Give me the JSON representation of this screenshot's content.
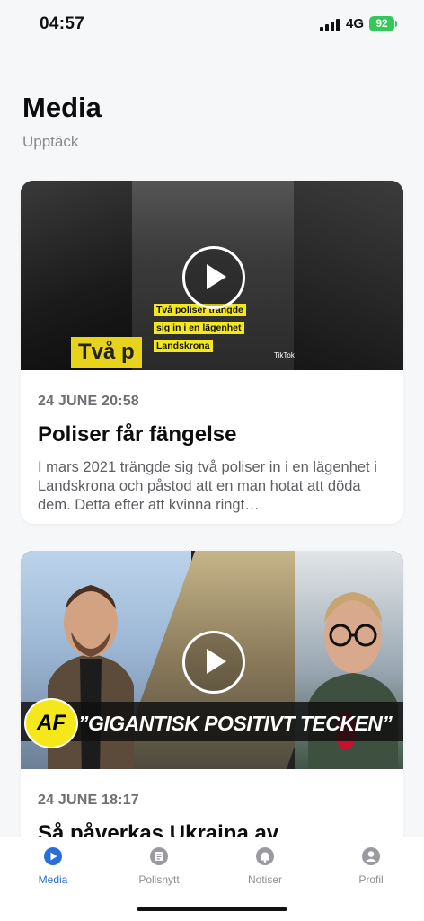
{
  "status_bar": {
    "time": "04:57",
    "network": "4G",
    "battery": "92"
  },
  "page": {
    "title": "Media",
    "subtitle": "Upptäck"
  },
  "articles": [
    {
      "date": "24 JUNE 20:58",
      "title": "Poliser får fängelse",
      "description": "I mars 2021 trängde sig två poliser in i en lägenhet i Landskrona och påstod att en man hotat att döda dem. Detta efter att kvinna ringt…",
      "thumb": {
        "caption_lines": [
          "Två poliser trängde",
          "sig in i en lägenhet",
          "Landskrona"
        ],
        "big_text": "Två p",
        "watermark": "TikTok"
      }
    },
    {
      "date": "24 JUNE 18:17",
      "title": "Så påverkas Ukraina av",
      "thumb": {
        "logo": "AF",
        "banner": "”GIGANTISK POSITIVT TECKEN”"
      }
    }
  ],
  "tabs": [
    {
      "label": "Media",
      "icon": "play-circle-icon",
      "active": true
    },
    {
      "label": "Polisnytt",
      "icon": "news-icon",
      "active": false
    },
    {
      "label": "Notiser",
      "icon": "bell-icon",
      "active": false
    },
    {
      "label": "Profil",
      "icon": "profile-icon",
      "active": false
    }
  ],
  "colors": {
    "accent": "#2a6fd9",
    "af_yellow": "#f4e81a",
    "background": "#f6f7f9"
  }
}
